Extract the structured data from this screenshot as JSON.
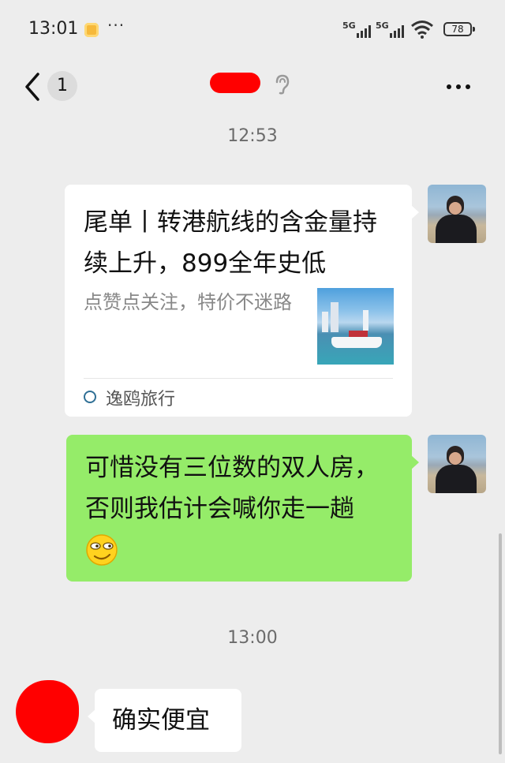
{
  "status_bar": {
    "time": "13:01",
    "more": "···",
    "network_1": "5G",
    "network_2": "5G",
    "battery": "78"
  },
  "header": {
    "unread_count": "1"
  },
  "chat": {
    "time_1": "12:53",
    "link_card": {
      "title": "尾单丨转港航线的含金量持续上升，899全年史低",
      "description": "点赞点关注，特价不迷路",
      "source": "逸鸥旅行"
    },
    "message_2": "可惜没有三位数的双人房，否则我估计会喊你走一趟",
    "time_2": "13:00",
    "message_3": "确实便宜"
  },
  "colors": {
    "background": "#ededed",
    "sent_bubble": "#95ec69",
    "received_bubble": "#ffffff",
    "redaction": "#ff0000"
  },
  "icons": [
    "back-chevron-icon",
    "ear-icon",
    "more-dots-icon",
    "wifi-icon",
    "battery-icon",
    "smirk-emoji-icon"
  ]
}
